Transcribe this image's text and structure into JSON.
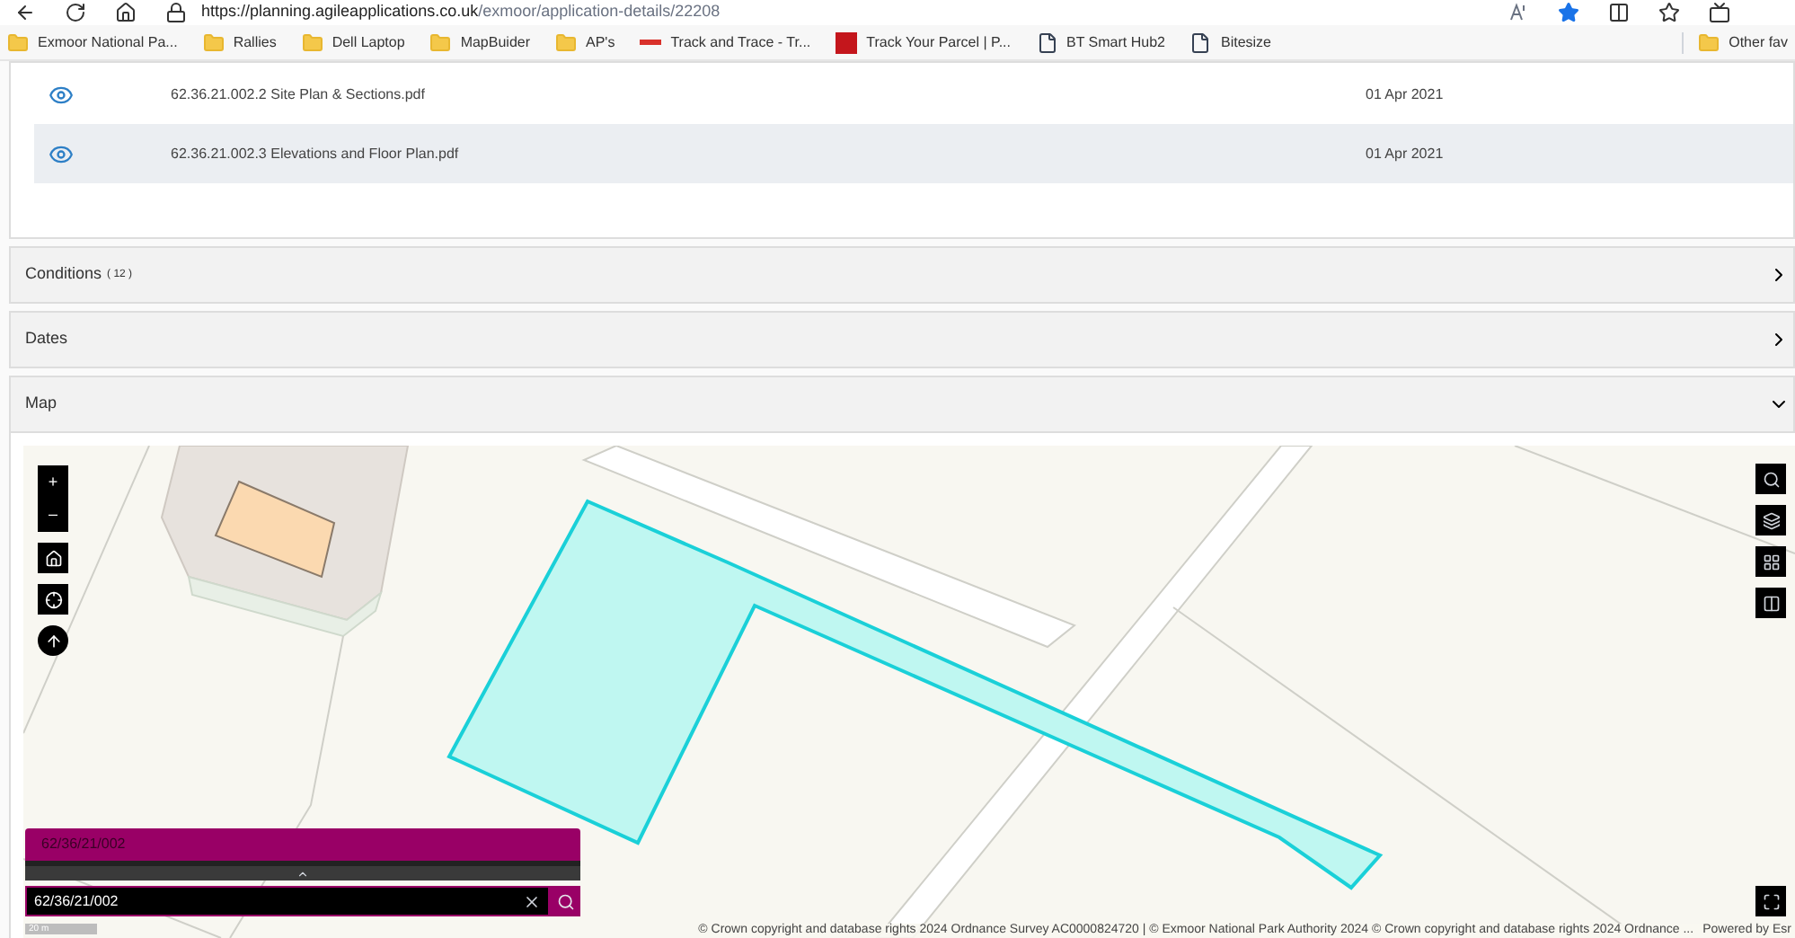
{
  "browser": {
    "url_host": "https://planning.agileapplications.co.uk",
    "url_path": "/exmoor/application-details/22208",
    "favorite": true,
    "bookmarks": [
      {
        "label": "Exmoor National Pa...",
        "kind": "folder"
      },
      {
        "label": "Rallies",
        "kind": "folder"
      },
      {
        "label": "Dell Laptop",
        "kind": "folder"
      },
      {
        "label": "MapBuider",
        "kind": "folder"
      },
      {
        "label": "AP's",
        "kind": "folder"
      },
      {
        "label": "Track and Trace - Tr...",
        "kind": "track"
      },
      {
        "label": "Track Your Parcel | P...",
        "kind": "parcel"
      },
      {
        "label": "BT Smart Hub2",
        "kind": "page"
      },
      {
        "label": "Bitesize",
        "kind": "page"
      }
    ],
    "other_favorites": "Other fav"
  },
  "documents": [
    {
      "name": "62.36.21.002.2 Site Plan & Sections.pdf",
      "date": "01 Apr 2021",
      "selected": false
    },
    {
      "name": "62.36.21.002.3 Elevations and Floor Plan.pdf",
      "date": "01 Apr 2021",
      "selected": true
    }
  ],
  "sections": [
    {
      "title": "Conditions",
      "count": "( 12 )",
      "expanded": false
    },
    {
      "title": "Dates",
      "expanded": false
    },
    {
      "title": "Map",
      "expanded": true
    }
  ],
  "map": {
    "zoom_in": "+",
    "zoom_out": "–",
    "search_result": "62/36/21/002",
    "search_value": "62/36/21/002",
    "scale": "20 m",
    "attribution": "© Crown copyright and database rights 2024 Ordnance Survey AC0000824720 | © Exmoor National Park Authority 2024 © Crown copyright and database rights 2024 Ordnance ...",
    "powered_by": "Powered by Esr"
  }
}
